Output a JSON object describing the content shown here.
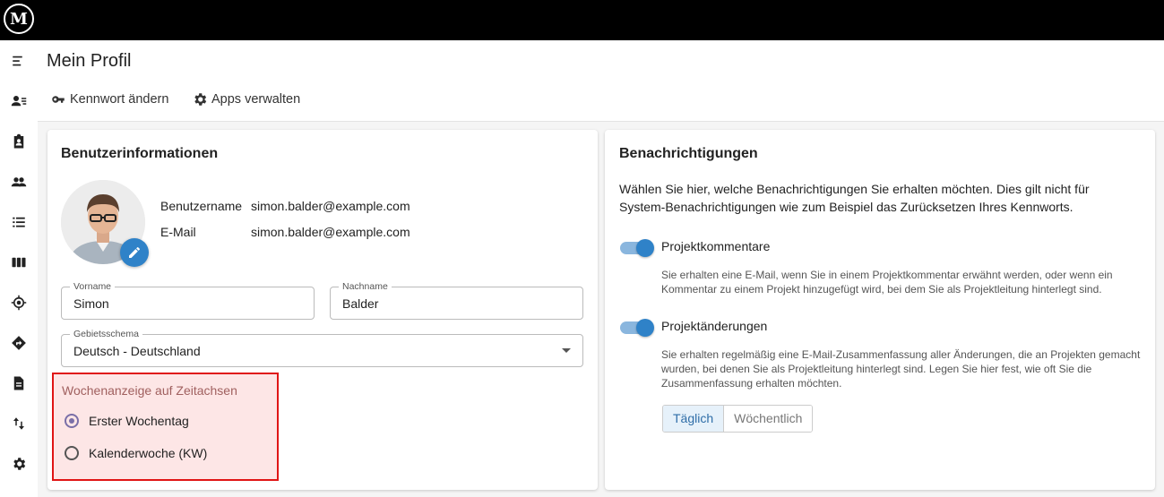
{
  "app": {
    "logo_text": "M"
  },
  "sidebar": {
    "items": [
      {
        "icon": "menu-icon"
      },
      {
        "icon": "user-list-icon"
      },
      {
        "icon": "clipboard-user-icon"
      },
      {
        "icon": "people-icon"
      },
      {
        "icon": "list-icon"
      },
      {
        "icon": "columns-icon"
      },
      {
        "icon": "location-icon"
      },
      {
        "icon": "directions-icon"
      },
      {
        "icon": "document-icon"
      },
      {
        "icon": "swap-icon"
      },
      {
        "icon": "gear-icon"
      }
    ]
  },
  "header": {
    "title": "Mein Profil",
    "change_password_label": "Kennwort ändern",
    "manage_apps_label": "Apps verwalten"
  },
  "user_info": {
    "title": "Benutzerinformationen",
    "username_label": "Benutzername",
    "username_value": "simon.balder@example.com",
    "email_label": "E-Mail",
    "email_value": "simon.balder@example.com",
    "firstname_label": "Vorname",
    "firstname_value": "Simon",
    "lastname_label": "Nachname",
    "lastname_value": "Balder",
    "locale_label": "Gebietsschema",
    "locale_value": "Deutsch - Deutschland",
    "week_display_label": "Wochenanzeige auf Zeitachsen",
    "week_options": [
      {
        "label": "Erster Wochentag",
        "selected": true
      },
      {
        "label": "Kalenderwoche (KW)",
        "selected": false
      }
    ]
  },
  "notifications": {
    "title": "Benachrichtigungen",
    "intro": "Wählen Sie hier, welche Benachrichtigungen Sie erhalten möchten. Dies gilt nicht für System-Benachrichtigungen wie zum Beispiel das Zurücksetzen Ihres Kennworts.",
    "project_comments_label": "Projektkommentare",
    "project_comments_enabled": true,
    "project_comments_desc": "Sie erhalten eine E-Mail, wenn Sie in einem Projektkommentar erwähnt werden, oder wenn ein Kommentar zu einem Projekt hinzugefügt wird, bei dem Sie als Projektleitung hinterlegt sind.",
    "project_changes_label": "Projektänderungen",
    "project_changes_enabled": true,
    "project_changes_desc": "Sie erhalten regelmäßig eine E-Mail-Zusammenfassung aller Änderungen, die an Projekten gemacht wurden, bei denen Sie als Projektleitung hinterlegt sind. Legen Sie hier fest, wie oft Sie die Zusammenfassung erhalten möchten.",
    "frequency_options": [
      "Täglich",
      "Wöchentlich"
    ],
    "frequency_selected": "Täglich"
  },
  "colors": {
    "accent": "#2f82c8",
    "highlight_border": "#e01515",
    "highlight_fill": "#fde6e6",
    "topbar": "#000000"
  }
}
